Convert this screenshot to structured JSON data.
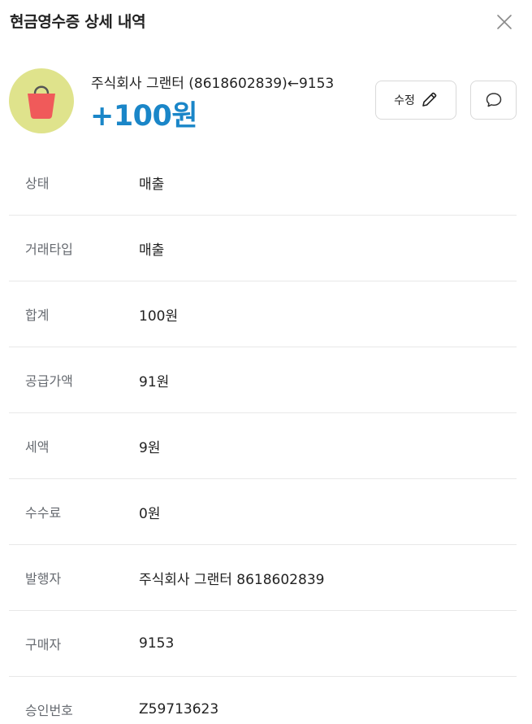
{
  "header": {
    "title": "현금영수증 상세 내역",
    "close_icon": "close-icon"
  },
  "summary": {
    "avatar_icon": "shopping-bag-icon",
    "avatar_bg": "#dfe38c",
    "bag_color": "#f05a5a",
    "merchant_line": "주식회사 그랜터 (8618602839)←9153",
    "amount": "+100원",
    "amount_color": "#1a86c8",
    "edit_label": "수정",
    "edit_icon": "pencil-icon",
    "comment_icon": "speech-bubble-icon"
  },
  "details": [
    {
      "label": "상태",
      "value": "매출"
    },
    {
      "label": "거래타입",
      "value": "매출"
    },
    {
      "label": "합계",
      "value": "100원"
    },
    {
      "label": "공급가액",
      "value": "91원"
    },
    {
      "label": "세액",
      "value": "9원"
    },
    {
      "label": "수수료",
      "value": "0원"
    },
    {
      "label": "발행자",
      "value": "주식회사 그랜터 8618602839"
    },
    {
      "label": "구매자",
      "value": "9153"
    },
    {
      "label": "승인번호",
      "value": "Z59713623"
    }
  ]
}
